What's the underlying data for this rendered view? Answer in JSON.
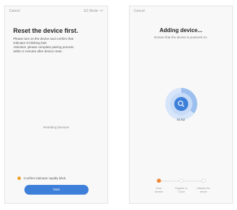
{
  "left_screen": {
    "cancel_label": "Cancel",
    "mode_label": "EZ Mode",
    "title": "Reset the device first.",
    "instructions": [
      "Please turn on the device and confirm that",
      "indicator is blinking fast.",
      "Attention: please complete pairing process",
      "within 3 minutes after device reset."
    ],
    "handling_text": "Resetting Devices",
    "confirm_text": "Confirm indicator rapidly blink",
    "next_label": "Next"
  },
  "right_screen": {
    "cancel_label": "Cancel",
    "title": "Adding device...",
    "subtitle": "Ensure that the device is powered on.",
    "timer": "01:52",
    "progress_fraction": 0.35,
    "steps": [
      {
        "label_line1": "Scan",
        "label_line2": "devices"
      },
      {
        "label_line1": "Register to",
        "label_line2": "Cloud"
      },
      {
        "label_line1": "Initialize the",
        "label_line2": "device"
      }
    ],
    "active_step": 0
  },
  "colors": {
    "accent": "#3d7fd9",
    "indicator": "#f0a030",
    "active_step": "#f08a3c"
  },
  "icons": {
    "mode_dropdown": "chevron-down-icon",
    "spinner_center": "search-icon"
  }
}
